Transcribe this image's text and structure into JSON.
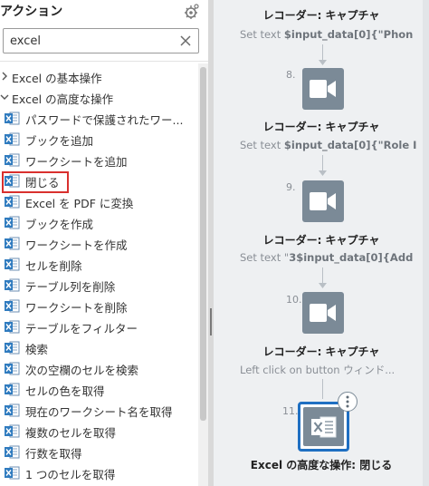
{
  "actions_panel": {
    "title": "アクション",
    "search_value": "excel",
    "categories": [
      {
        "label": "Excel の基本操作",
        "expanded": false
      },
      {
        "label": "Excel の高度な操作",
        "expanded": true
      }
    ],
    "items": [
      "パスワードで保護されたワー...",
      "ブックを追加",
      "ワークシートを追加",
      "閉じる",
      "Excel を PDF に変換",
      "ブックを作成",
      "ワークシートを作成",
      "セルを削除",
      "テーブル列を削除",
      "ワークシートを削除",
      "テーブルをフィルター",
      "検索",
      "次の空欄のセルを検索",
      "セルの色を取得",
      "現在のワークシート名を取得",
      "複数のセルを取得",
      "行数を取得",
      "1 つのセルを取得"
    ],
    "selected_item": "閉じる"
  },
  "flow": {
    "step7": {
      "title": "レコーダー: キャプチャ",
      "subtitle_prefix": "Set text ",
      "subtitle_bold": "$input_data[0]{\"Phon"
    },
    "step8": {
      "number": "8.",
      "title": "レコーダー: キャプチャ",
      "subtitle_prefix": "Set text ",
      "subtitle_bold": "$input_data[0]{\"Role I"
    },
    "step9": {
      "number": "9.",
      "title": "レコーダー: キャプチャ",
      "subtitle_prefix": "Set text \"",
      "subtitle_bold": "3$input_data[0]{Add"
    },
    "step10": {
      "number": "10.",
      "title": "レコーダー: キャプチャ",
      "subtitle": "Left click on button ウィンド..."
    },
    "step11": {
      "number": "11.",
      "title": "Excel の高度な操作: 閉じる"
    }
  },
  "colors": {
    "accent": "#1f6fc2",
    "selection_outline": "#d9302e",
    "excel_green": "#2f7bbf",
    "tile": "#7b8a97"
  }
}
